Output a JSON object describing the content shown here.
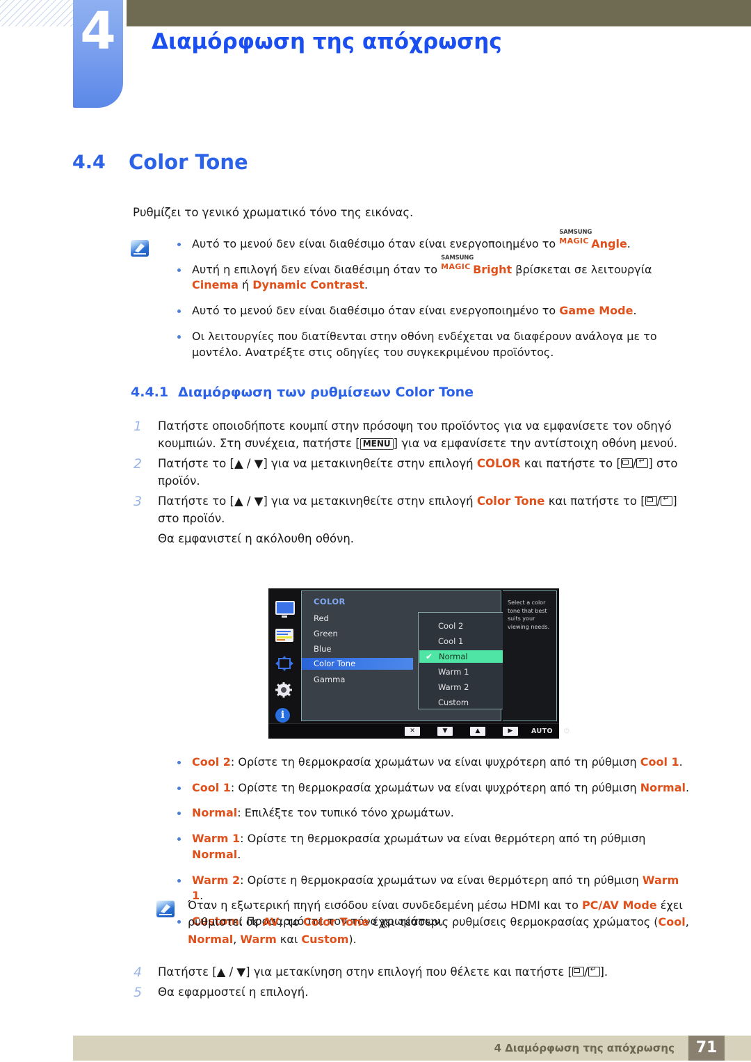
{
  "header": {
    "chapter_number": "4",
    "chapter_title": "Διαμόρφωση της απόχρωσης"
  },
  "section": {
    "number": "4.4",
    "title": "Color Tone",
    "intro": "Ρυθμίζει το γενικό χρωματικό τόνο της εικόνας."
  },
  "note1": {
    "icon": "note-pencil-icon",
    "bullets": [
      {
        "pre": "Αυτό το μενού δεν είναι διαθέσιμο όταν είναι ενεργοποιημένο το ",
        "magic_top": "SAMSUNG",
        "magic_bottom": "MAGIC",
        "magic_suffix": "Angle",
        "post": "."
      },
      {
        "pre": "Αυτή η επιλογή δεν είναι διαθέσιμη όταν το ",
        "magic_top": "SAMSUNG",
        "magic_bottom": "MAGIC",
        "magic_suffix": "Bright",
        "mid": " βρίσκεται σε λειτουργία ",
        "em1": "Cinema",
        "mid2": " ή ",
        "em2": "Dynamic Contrast",
        "post": "."
      },
      {
        "pre": "Αυτό το μενού δεν είναι διαθέσιμο όταν είναι ενεργοποιημένο το ",
        "em1": "Game Mode",
        "post": "."
      },
      {
        "pre": "Οι λειτουργίες που διατίθενται στην οθόνη ενδέχεται να διαφέρουν ανάλογα με το μοντέλο. Ανατρέξτε στις οδηγίες του συγκεκριμένου προϊόντος.",
        "post": ""
      }
    ]
  },
  "subsection": {
    "number": "4.4.1",
    "title": "Διαμόρφωση των ρυθμίσεων Color Tone"
  },
  "steps": {
    "s1_num": "1",
    "s1_a": "Πατήστε οποιοδήποτε κουμπί στην πρόσοψη του προϊόντος για να εμφανίσετε τον οδηγό κουμπιών. Στη συνέχεια, πατήστε [",
    "s1_key": "MENU",
    "s1_b": "] για να εμφανίσετε την αντίστοιχη οθόνη μενού.",
    "s2_num": "2",
    "s2_a": "Πατήστε το [▲ / ▼] για να μετακινηθείτε στην επιλογή ",
    "s2_em": "COLOR",
    "s2_b": " και πατήστε το [",
    "s2_c": "] στο προϊόν.",
    "s3_num": "3",
    "s3_a": "Πατήστε το [▲ / ▼] για να μετακινηθείτε στην επιλογή ",
    "s3_em": "Color Tone",
    "s3_b": " και πατήστε το [",
    "s3_c": "] στο προϊόν.",
    "s3_note": "Θα εμφανιστεί η ακόλουθη οθόνη.",
    "s4_num": "4",
    "s4_a": "Πατήστε [▲ / ▼] για μετακίνηση στην επιλογή που θέλετε και πατήστε [",
    "s4_b": "].",
    "s5_num": "5",
    "s5_a": "Θα εφαρμοστεί η επιλογή."
  },
  "osd": {
    "menu_title": "COLOR",
    "items": [
      "Red",
      "Green",
      "Blue",
      "Color Tone",
      "Gamma"
    ],
    "selected_item": "Color Tone",
    "submenu": [
      "Cool 2",
      "Cool 1",
      "Normal",
      "Warm 1",
      "Warm 2",
      "Custom"
    ],
    "submenu_selected": "Normal",
    "submenu_check": "✔",
    "description": "Select a color tone that best suits your viewing needs.",
    "sidebar_icons": [
      "monitor-icon",
      "color-bars-icon",
      "four-arrows-icon",
      "gear-icon",
      "info-icon"
    ],
    "buttons": {
      "close": "✕",
      "down": "▼",
      "up": "▲",
      "right": "▶",
      "auto": "AUTO",
      "power": "⏻"
    },
    "accent_highlight": "#4fe6a5",
    "accent_selection": "#3f7ce8"
  },
  "options": [
    {
      "name": "Cool 2",
      "pre": ": Ορίστε τη θερμοκρασία χρωμάτων να είναι ψυχρότερη από τη ρύθμιση ",
      "ref": "Cool 1",
      "post": "."
    },
    {
      "name": "Cool 1",
      "pre": ": Ορίστε τη θερμοκρασία χρωμάτων να είναι ψυχρότερη από τη ρύθμιση ",
      "ref": "Normal",
      "post": "."
    },
    {
      "name": "Normal",
      "pre": ": Επιλέξτε τον τυπικό τόνο χρωμάτων.",
      "ref": "",
      "post": ""
    },
    {
      "name": "Warm 1",
      "pre": ": Ορίστε τη θερμοκρασία χρωμάτων να είναι θερμότερη από τη ρύθμιση ",
      "ref": "Normal",
      "post": "."
    },
    {
      "name": "Warm 2",
      "pre": ": Ορίστε η θερμοκρασία χρωμάτων να είναι θερμότερη από τη ρύθμιση ",
      "ref": "Warm 1",
      "post": "."
    },
    {
      "name": "Custom",
      "pre": ": Προσαρμόστε τον τόνο χρωμάτων.",
      "ref": "",
      "post": ""
    }
  ],
  "note2": {
    "icon": "note-pencil-icon",
    "a": "Όταν η εξωτερική πηγή εισόδου είναι συνδεδεμένη μέσω HDMI και το ",
    "em1": "PC/AV Mode",
    "b": " έχει ρυθμιστεί σε ",
    "em2": "AV",
    "c": ", το ",
    "em3": "Color Tone",
    "d": " έχει τέσσερις ρυθμίσεις θερμοκρασίας χρώματος (",
    "em4": "Cool",
    "e": ", ",
    "em5": "Normal",
    "f": ", ",
    "em6": "Warm",
    "g": " και ",
    "em7": "Custom",
    "h": ")."
  },
  "footer": {
    "text": "4 Διαμόρφωση της απόχρωσης",
    "page": "71"
  }
}
